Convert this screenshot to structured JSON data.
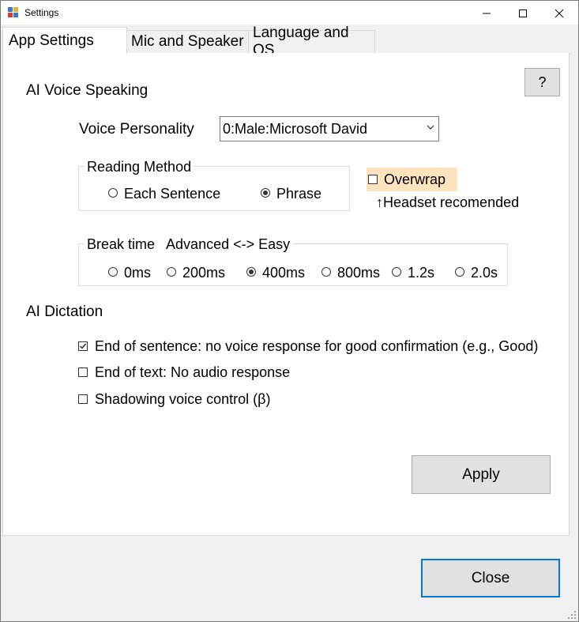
{
  "window": {
    "title": "Settings",
    "minimize_glyph": "—",
    "maximize_glyph": "☐",
    "close_glyph": "✕"
  },
  "tabs": [
    {
      "label": "App Settings",
      "active": true
    },
    {
      "label": "Mic and Speaker",
      "active": false
    },
    {
      "label": "Language and OS",
      "active": false
    }
  ],
  "help_button": {
    "label": "?"
  },
  "voice_speaking": {
    "section_title": "AI Voice Speaking",
    "personality_label": "Voice Personality",
    "personality_value": "0:Male:Microsoft David",
    "reading_method": {
      "title": "Reading Method",
      "options": [
        {
          "label": "Each Sentence",
          "selected": false
        },
        {
          "label": "Phrase",
          "selected": true
        }
      ]
    },
    "overwrap": {
      "label": "Overwrap",
      "checked": false,
      "highlight_color": "#fde4be"
    },
    "headset_note": "↑Headset recomended",
    "break_time": {
      "title": "Break time   Advanced <-> Easy",
      "options": [
        {
          "label": "0ms",
          "selected": false
        },
        {
          "label": "200ms",
          "selected": false
        },
        {
          "label": "400ms",
          "selected": true
        },
        {
          "label": "800ms",
          "selected": false
        },
        {
          "label": "1.2s",
          "selected": false
        },
        {
          "label": "2.0s",
          "selected": false
        }
      ]
    }
  },
  "dictation": {
    "section_title": "AI Dictation",
    "options": [
      {
        "label": "End of sentence: no voice response for good confirmation (e.g., Good)",
        "checked": true
      },
      {
        "label": "End of text: No audio response",
        "checked": false
      },
      {
        "label": "Shadowing voice control (β)",
        "checked": false
      }
    ]
  },
  "apply_button": {
    "label": "Apply"
  },
  "close_button": {
    "label": "Close",
    "border_color": "#0078d7"
  }
}
